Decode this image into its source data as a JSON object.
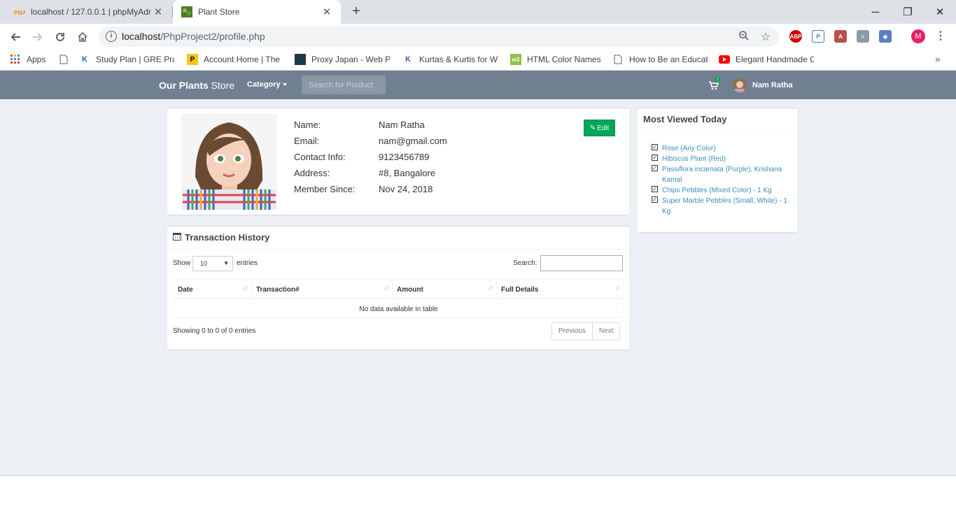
{
  "browser": {
    "tabs": [
      {
        "title": "localhost / 127.0.0.1 | phpMyAdm",
        "favicon": "phpmyadmin-icon"
      },
      {
        "title": "Plant Store",
        "favicon": "plant-icon"
      }
    ],
    "url_host": "localhost",
    "url_path": "/PhpProject2/profile.php",
    "profile_initial": "M",
    "bookmarks": [
      {
        "label": "Apps",
        "icon": "apps-grid-icon"
      },
      {
        "label": "",
        "icon": "page-icon"
      },
      {
        "label": "Study Plan | GRE Prac",
        "icon": "k-logo-icon"
      },
      {
        "label": "Account Home | The",
        "icon": "p-logo-icon"
      },
      {
        "label": "Proxy Japan - Web Pr",
        "icon": "proxy-icon"
      },
      {
        "label": "Kurtas & Kurtis for W",
        "icon": "k-purple-icon"
      },
      {
        "label": "HTML Color Names",
        "icon": "w3-icon"
      },
      {
        "label": "How to Be an Educat",
        "icon": "page-icon"
      },
      {
        "label": "Elegant Handmade C",
        "icon": "youtube-icon"
      }
    ],
    "more_bookmarks": "»"
  },
  "navbar": {
    "brand_bold": "Our Plants",
    "brand_rest": " Store",
    "category": "Category",
    "search_placeholder": "Search for Product",
    "cart_count": "1",
    "user_name": "Nam Ratha"
  },
  "profile": {
    "labels": {
      "name": "Name:",
      "email": "Email:",
      "contact": "Contact Info:",
      "address": "Address:",
      "member_since": "Member Since:"
    },
    "values": {
      "name": "Nam Ratha",
      "email": "nam@gmail.com",
      "contact": "9123456789",
      "address": "#8, Bangalore",
      "member_since": "Nov 24, 2018"
    },
    "edit_label": "Edit"
  },
  "transactions": {
    "title": "Transaction History",
    "show": "Show",
    "entries_value": "10",
    "entries": "entries",
    "search_label": "Search:",
    "columns": [
      "Date",
      "Transaction#",
      "Amount",
      "Full Details"
    ],
    "empty_text": "No data available in table",
    "info": "Showing 0 to 0 of 0 entries",
    "prev": "Previous",
    "next": "Next"
  },
  "most_viewed": {
    "title": "Most Viewed Today",
    "items": [
      "Rose (Any Color)",
      "Hibiscus Plant (Red)",
      "Passiflora incarnata (Purple), Krishana Kamal",
      "Chips Pebbles (Mixed Color) - 1 Kg",
      "Super Marble Pebbles (Small, White) - 1 Kg"
    ]
  },
  "colors": {
    "navbar": "#708090",
    "edit_button": "#00a65a",
    "link": "#3c8dbc",
    "page_bg": "#ecf0f5"
  }
}
